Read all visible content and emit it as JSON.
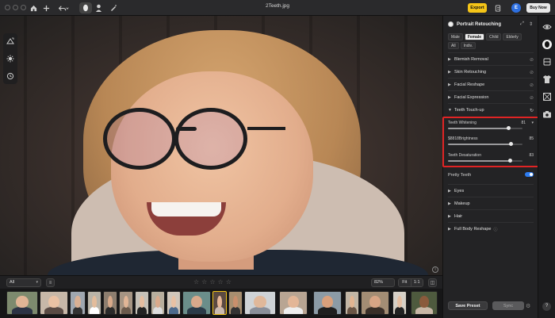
{
  "window": {
    "title": "2Teeth.jpg"
  },
  "toolbar": {
    "icons": [
      "home-icon",
      "plus-icon",
      "undo-icon",
      "face-icon",
      "person-icon",
      "brush-icon"
    ],
    "export_label": "Export",
    "account_initial": "E",
    "buy_label": "Buy Now"
  },
  "canvas": {
    "tools": [
      "crop-icon",
      "adjust-icon",
      "history-icon"
    ]
  },
  "strip_bar": {
    "album": "All",
    "stars": [
      "☆",
      "☆",
      "☆",
      "☆",
      "☆"
    ],
    "zoom": "82%",
    "fit_label": "Fit",
    "ratio_label": "1:1"
  },
  "panel": {
    "title": "Portrait Retouching",
    "genders": [
      "Male",
      "Female",
      "Child",
      "Elderly",
      "All",
      "Indiv."
    ],
    "selected_gender": "Female",
    "sections_top": [
      {
        "label": "Blemish Removal"
      },
      {
        "label": "Skin Retouching"
      },
      {
        "label": "Facial Reshape"
      },
      {
        "label": "Facial Expression"
      },
      {
        "label": "Teeth Touch-up"
      }
    ],
    "sliders": [
      {
        "label": "Teeth Whitening",
        "value": "81",
        "fraction": 0.81
      },
      {
        "label": "$8818Brightness",
        "value": "85",
        "fraction": 0.85
      },
      {
        "label": "Teeth Desaturation",
        "value": "83",
        "fraction": 0.83
      }
    ],
    "pretty_teeth_label": "Pretty Teeth",
    "sections_bottom": [
      {
        "label": "Eyes"
      },
      {
        "label": "Makeup"
      },
      {
        "label": "Hair"
      },
      {
        "label": "Full Body Reshape"
      }
    ],
    "save_preset_label": "Save Preset",
    "sync_label": "Sync"
  },
  "right_strip": {
    "icons": [
      "portrait-icon",
      "face-icon",
      "layers-icon",
      "shirt-icon",
      "background-icon",
      "camera-icon"
    ]
  },
  "help_label": "?",
  "info_label": "i"
}
